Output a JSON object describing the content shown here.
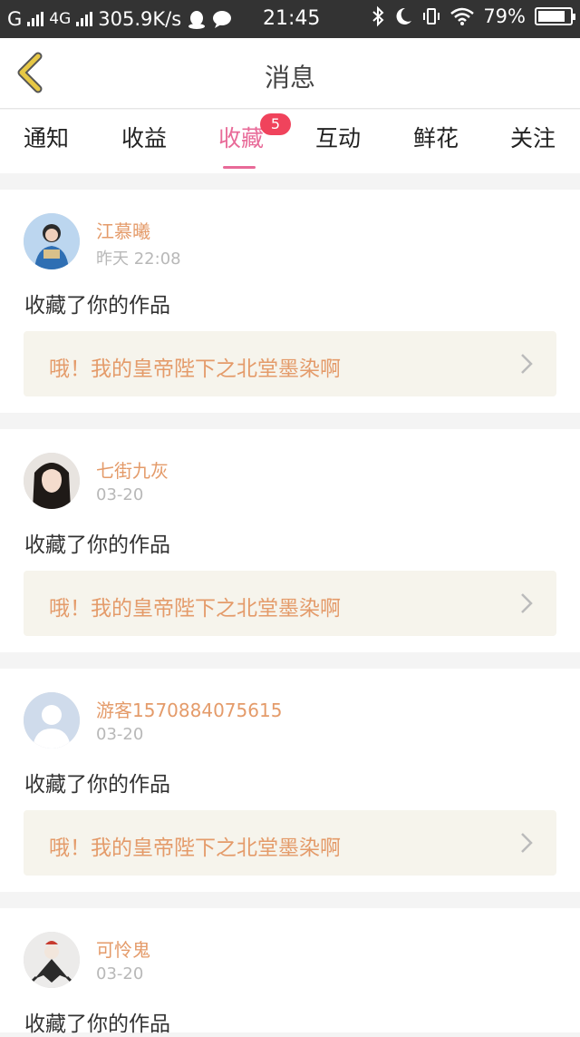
{
  "status_bar": {
    "carrier1": "G",
    "carrier2": "4G",
    "speed": "305.9K/s",
    "time": "21:45",
    "battery": "79%"
  },
  "header": {
    "title": "消息"
  },
  "tabs": [
    {
      "label": "通知"
    },
    {
      "label": "收益"
    },
    {
      "label": "收藏",
      "badge": "5",
      "active": true
    },
    {
      "label": "互动"
    },
    {
      "label": "鲜花"
    },
    {
      "label": "关注"
    }
  ],
  "feed": [
    {
      "name": "江慕曦",
      "time": "昨天 22:08",
      "action": "收藏了你的作品",
      "work": "哦！我的皇帝陛下之北堂墨染啊"
    },
    {
      "name": "七街九灰",
      "time": "03-20",
      "action": "收藏了你的作品",
      "work": "哦！我的皇帝陛下之北堂墨染啊"
    },
    {
      "name": "游客1570884075615",
      "time": "03-20",
      "action": "收藏了你的作品",
      "work": "哦！我的皇帝陛下之北堂墨染啊"
    },
    {
      "name": "可怜鬼",
      "time": "03-20",
      "action": "收藏了你的作品"
    }
  ],
  "colors": {
    "accent": "#e86a98",
    "name": "#e49b6a",
    "badge": "#f0435c",
    "back_arrow": "#e7c845"
  }
}
